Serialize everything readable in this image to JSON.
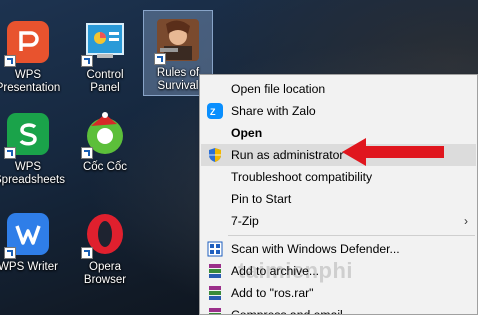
{
  "desktop": {
    "icons": [
      {
        "label1": "WPS",
        "label2": "Presentation"
      },
      {
        "label1": "Control",
        "label2": "Panel"
      },
      {
        "label1": "Rules of",
        "label2": "Survival"
      },
      {
        "label1": "WPS",
        "label2": "Spreadsheets"
      },
      {
        "label1": "Cốc Cốc",
        "label2": ""
      },
      {
        "label1": "WPS Writer",
        "label2": ""
      },
      {
        "label1": "Opera",
        "label2": "Browser"
      }
    ]
  },
  "context_menu": {
    "items": [
      {
        "label": "Open file location"
      },
      {
        "label": "Share with Zalo"
      },
      {
        "label": "Open"
      },
      {
        "label": "Run as administrator"
      },
      {
        "label": "Troubleshoot compatibility"
      },
      {
        "label": "Pin to Start"
      },
      {
        "label": "7-Zip"
      },
      {
        "label": "Scan with Windows Defender..."
      },
      {
        "label": "Add to archive..."
      },
      {
        "label": "Add to \"ros.rar\""
      },
      {
        "label": "Compress and email..."
      }
    ],
    "submenu_arrow": "›"
  },
  "watermark": "taimienphi",
  "colors": {
    "highlight": "#dcdcdc",
    "arrow": "#e0161e",
    "menu_bg": "#f2f2f2"
  }
}
